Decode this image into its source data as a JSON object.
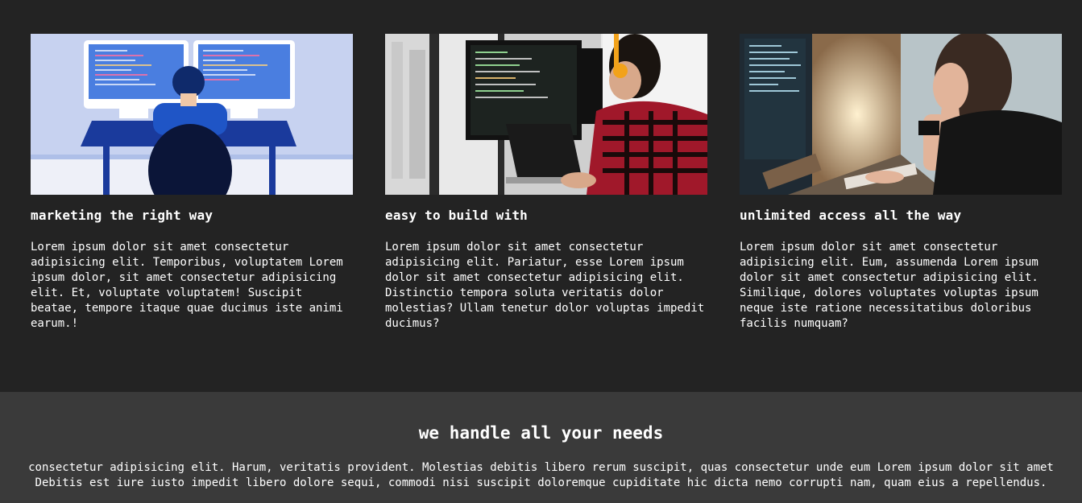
{
  "features": [
    {
      "image": "developer-illustration-image",
      "title": "marketing the right way",
      "text": "Lorem ipsum dolor sit amet consectetur adipisicing elit. Temporibus, voluptatem Lorem ipsum dolor, sit amet consectetur adipisicing elit. Et, voluptate voluptatem! Suscipit beatae, tempore itaque quae ducimus iste animi earum.!"
    },
    {
      "image": "developer-with-headphones-photo",
      "title": "easy to build with",
      "text": "Lorem ipsum dolor sit amet consectetur adipisicing elit. Pariatur, esse Lorem ipsum dolor sit amet consectetur adipisicing elit. Distinctio tempora soluta veritatis dolor molestias? Ullam tenetur dolor voluptas impedit ducimus?"
    },
    {
      "image": "thinking-developer-photo",
      "title": "unlimited access all the way",
      "text": "Lorem ipsum dolor sit amet consectetur adipisicing elit. Eum, assumenda Lorem ipsum dolor sit amet consectetur adipisicing elit. Similique, dolores voluptates voluptas ipsum neque iste ratione necessitatibus doloribus facilis numquam?"
    }
  ],
  "needs": {
    "title": "we handle all your needs",
    "line1": "consectetur adipisicing elit. Harum, veritatis provident. Molestias debitis libero rerum suscipit, quas consectetur unde eum Lorem ipsum dolor sit amet",
    "line2": "Debitis est iure iusto impedit libero dolore sequi, commodi nisi suscipit doloremque cupiditate hic dicta nemo corrupti nam, quam eius a repellendus."
  },
  "colors": {
    "page_background": "#232323",
    "needs_background": "#3a3a3a",
    "text": "#ffffff"
  }
}
